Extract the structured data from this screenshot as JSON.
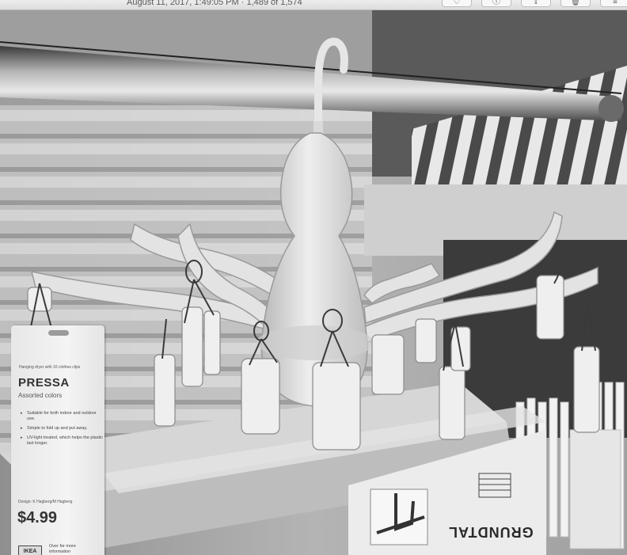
{
  "viewer": {
    "title": "August 11, 2017, 1:49:05 PM  ·  1,489 of 1,574",
    "toolbar": [
      {
        "name": "favorite-button",
        "icon": "heart-icon",
        "glyph": "♡"
      },
      {
        "name": "info-button",
        "icon": "info-icon",
        "glyph": "ⓘ"
      },
      {
        "name": "share-button",
        "icon": "share-icon",
        "glyph": "⇪"
      },
      {
        "name": "delete-button",
        "icon": "trash-icon",
        "glyph": "🗑"
      },
      {
        "name": "adjust-button",
        "icon": "sliders-icon",
        "glyph": "≡"
      }
    ]
  },
  "photo": {
    "price_tag": {
      "subtitle": "Hanging dryer with 16 clothes clips",
      "product_name": "PRESSA",
      "variant": "Assorted colors",
      "features": [
        "Suitable for both indoor and outdoor use.",
        "Simple to fold up and put away.",
        "UV-light treated, which helps the plastic last longer."
      ],
      "designer": "Design: K Hagberg/M Hagberg",
      "price": "$4.99",
      "logo": "IKEA",
      "more_info": "Over for more information"
    },
    "box_label": "GRUNDTAL"
  }
}
